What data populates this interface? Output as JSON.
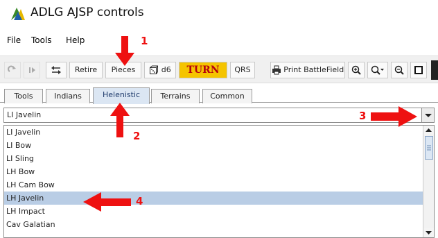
{
  "window": {
    "title": "ADLG AJSP controls"
  },
  "menu": {
    "file": "File",
    "tools": "Tools",
    "help": "Help"
  },
  "toolbar": {
    "retire": "Retire",
    "pieces": "Pieces",
    "d6": "d6",
    "turn": "TURN",
    "qrs": "QRS",
    "print": "Print BattleField"
  },
  "tabs": [
    "Tools",
    "Indians",
    "Helenistic",
    "Terrains",
    "Common"
  ],
  "combo": {
    "value": "LI Javelin"
  },
  "list": {
    "items": [
      "LI Javelin",
      "LI Bow",
      "LI Sling",
      "LH Bow",
      "LH Cam Bow",
      "LH Javelin",
      "LH Impact",
      "Cav Galatian"
    ]
  },
  "annotations": {
    "a1": "1",
    "a2": "2",
    "a3": "3",
    "a4": "4"
  },
  "colors": {
    "annotation": "#ee1111",
    "selection": "#b9cde5",
    "turn_bg": "#f5c400",
    "turn_text": "#b5000d"
  }
}
